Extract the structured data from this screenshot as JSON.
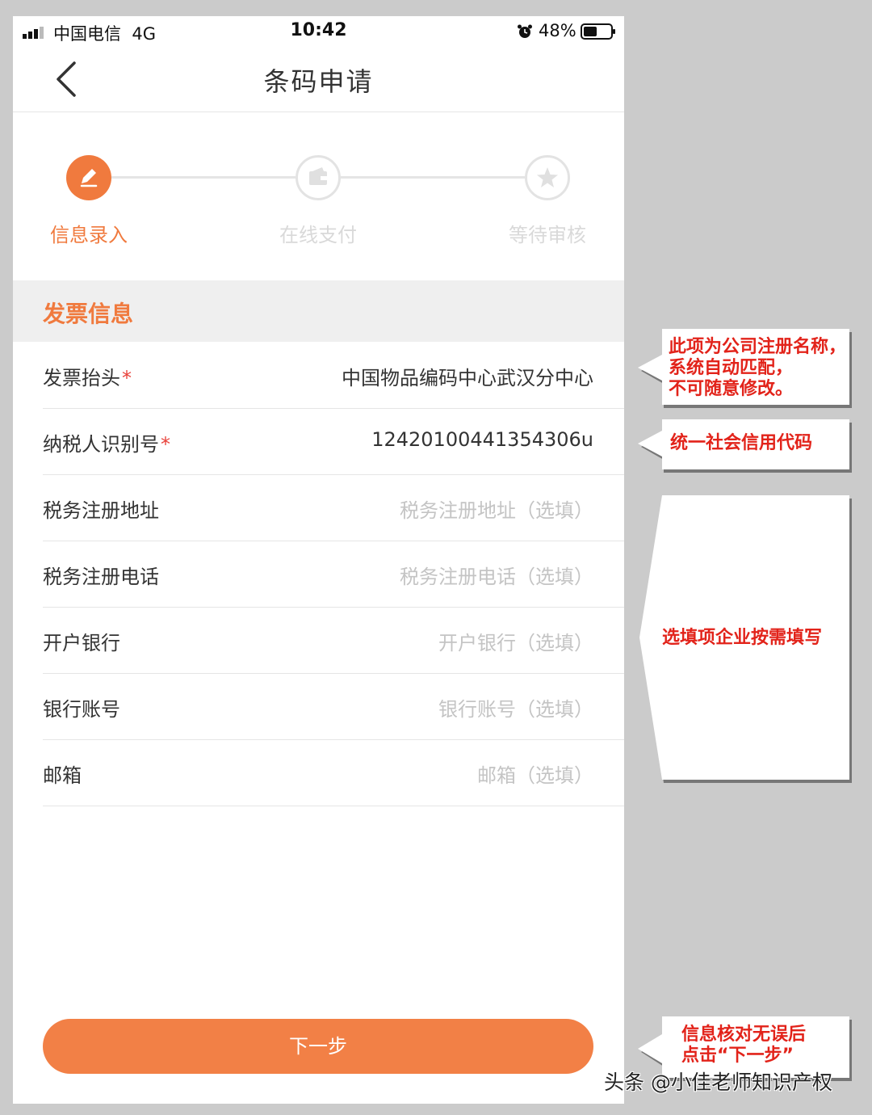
{
  "status_bar": {
    "carrier": "中国电信",
    "network": "4G",
    "time": "10:42",
    "battery": "48%"
  },
  "nav": {
    "title": "条码申请",
    "back_icon": "chevron-left-icon"
  },
  "steps": [
    {
      "label": "信息录入",
      "state": "active",
      "icon": "edit-pencil-icon"
    },
    {
      "label": "在线支付",
      "state": "inactive",
      "icon": "wallet-icon"
    },
    {
      "label": "等待审核",
      "state": "inactive",
      "icon": "star-icon"
    }
  ],
  "section": {
    "title": "发票信息"
  },
  "form": {
    "rows": [
      {
        "label": "发票抬头",
        "required": "*",
        "value": "中国物品编码中心武汉分中心",
        "placeholder": ""
      },
      {
        "label": "纳税人识别号",
        "required": "*",
        "value": "12420100441354306u",
        "placeholder": ""
      },
      {
        "label": "税务注册地址",
        "required": "",
        "value": "",
        "placeholder": "税务注册地址（选填）"
      },
      {
        "label": "税务注册电话",
        "required": "",
        "value": "",
        "placeholder": "税务注册电话（选填）"
      },
      {
        "label": "开户银行",
        "required": "",
        "value": "",
        "placeholder": "开户银行（选填）"
      },
      {
        "label": "银行账号",
        "required": "",
        "value": "",
        "placeholder": "银行账号（选填）"
      },
      {
        "label": "邮箱",
        "required": "",
        "value": "",
        "placeholder": "邮箱（选填）"
      }
    ]
  },
  "next_button": {
    "label": "下一步"
  },
  "callouts": [
    {
      "lines": [
        "此项为公司注册名称，",
        "系统自动匹配，",
        "不可随意修改。"
      ]
    },
    {
      "lines": [
        "统一社会信用代码"
      ]
    },
    {
      "lines": [
        "选填项企业按需填写"
      ]
    },
    {
      "lines": [
        "信息核对无误后",
        "点击“下一步”"
      ]
    }
  ],
  "watermark": "头条 @小佳老师知识产权",
  "colors": {
    "accent": "#f07a3e",
    "button": "#f28046",
    "required": "#e8413a",
    "callout_text": "#e2231a",
    "placeholder": "#c4c4c4"
  }
}
